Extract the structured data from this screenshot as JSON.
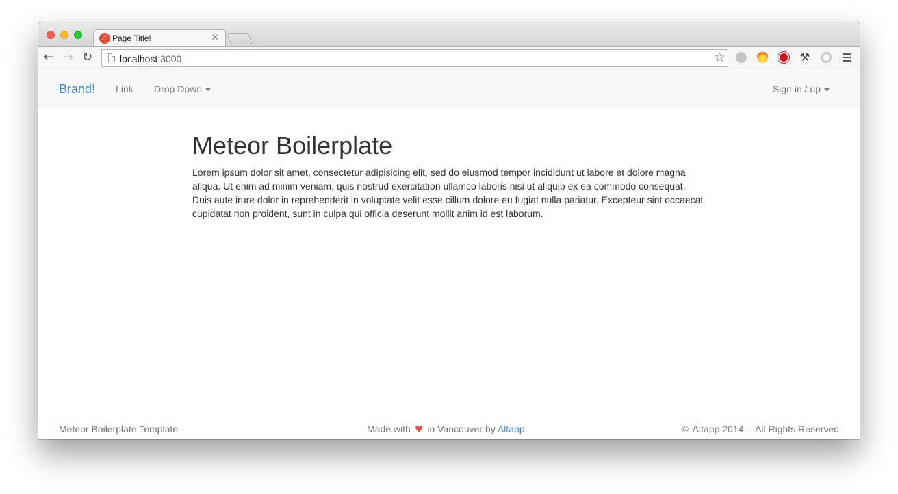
{
  "browser": {
    "tab_title": "Page Title!",
    "tab_favicon": "meteor-icon",
    "tab_close": "×",
    "url_host": "localhost",
    "url_port": ":3000",
    "icons": [
      "back-arrow-icon",
      "forward-arrow-icon",
      "reload-icon",
      "page-icon",
      "bookmark-star-icon",
      "ghost-extension-icon",
      "fire-extension-icon",
      "adblock-extension-icon",
      "wrench-extension-icon",
      "circle-extension-icon",
      "menu-icon"
    ]
  },
  "navbar": {
    "brand": "Brand!",
    "link": "Link",
    "dropdown": "Drop Down",
    "signin": "Sign in / up"
  },
  "content": {
    "title": "Meteor Boilerplate",
    "body": "Lorem ipsum dolor sit amet, consectetur adipisicing elit, sed do eiusmod tempor incididunt ut labore et dolore magna aliqua. Ut enim ad minim veniam, quis nostrud exercitation ullamco laboris nisi ut aliquip ex ea commodo consequat. Duis aute irure dolor in reprehenderit in voluptate velit esse cillum dolore eu fugiat nulla pariatur. Excepteur sint occaecat cupidatat non proident, sunt in culpa qui officia deserunt mollit anim id est laborum."
  },
  "footer": {
    "left": "Meteor Boilerplate Template",
    "made_with": "Made with",
    "heart": "♥",
    "in_city": "in Vancouver by",
    "author_link": "Altapp",
    "copyright_symbol": "©",
    "copyright_holder": "Altapp 2014",
    "separator": "·",
    "rights": "All Rights Reserved"
  },
  "colors": {
    "brand": "#428bca",
    "heart": "#d9534f",
    "navbar_bg": "#f8f8f8"
  }
}
